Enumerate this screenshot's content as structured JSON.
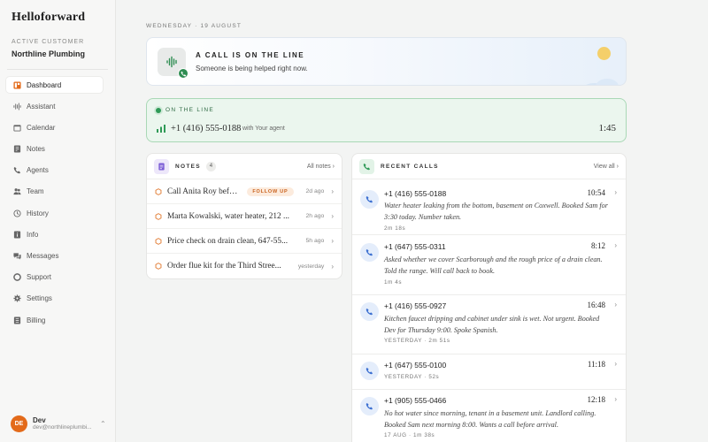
{
  "sidebar": {
    "brand": "Helloforward",
    "customer_label": "ACTIVE CUSTOMER",
    "customer_name": "Northline Plumbing",
    "items": [
      {
        "label": "Dashboard",
        "icon": "dashboard-icon",
        "active": true
      },
      {
        "label": "Assistant",
        "icon": "waveform-icon"
      },
      {
        "label": "Calendar",
        "icon": "calendar-icon"
      },
      {
        "label": "Notes",
        "icon": "note-icon"
      },
      {
        "label": "Agents",
        "icon": "phone-icon"
      },
      {
        "label": "Team",
        "icon": "team-icon"
      },
      {
        "label": "History",
        "icon": "history-icon"
      },
      {
        "label": "Info",
        "icon": "info-icon"
      },
      {
        "label": "Messages",
        "icon": "messages-icon"
      },
      {
        "label": "Support",
        "icon": "support-icon"
      },
      {
        "label": "Settings",
        "icon": "gear-icon"
      },
      {
        "label": "Billing",
        "icon": "billing-icon"
      }
    ],
    "user": {
      "initials": "DE",
      "name": "Dev",
      "email": "dev@northlineplumbi..."
    }
  },
  "main": {
    "date": "WEDNESDAY · 19 AUGUST",
    "banner": {
      "title": "A CALL IS ON THE LINE",
      "subtitle": "Someone is being helped right now."
    },
    "on_line": {
      "label": "ON THE LINE",
      "number": "+1 (416) 555-0188",
      "agent": "with Your agent",
      "duration": "1:45"
    },
    "notes": {
      "title": "NOTES",
      "count": "4",
      "link": "All notes",
      "items": [
        {
          "text": "Call Anita Roy before ...",
          "tag": "FOLLOW UP",
          "age": "2d ago"
        },
        {
          "text": "Marta Kowalski, water heater, 212 ...",
          "tag": "",
          "age": "2h ago"
        },
        {
          "text": "Price check on drain clean, 647-55...",
          "tag": "",
          "age": "5h ago"
        },
        {
          "text": "Order flue kit for the Third Stree...",
          "tag": "",
          "age": "yesterday"
        }
      ]
    },
    "calls": {
      "title": "RECENT CALLS",
      "link": "View all",
      "items": [
        {
          "number": "+1 (416) 555-0188",
          "time": "10:54",
          "desc": "Water heater leaking from the bottom, basement on Coxwell. Booked Sam for 3:30 today. Number taken.",
          "meta": "2m 18s"
        },
        {
          "number": "+1 (647) 555-0311",
          "time": "8:12",
          "desc": "Asked whether we cover Scarborough and the rough price of a drain clean. Told the range. Will call back to book.",
          "meta": "1m 4s"
        },
        {
          "number": "+1 (416) 555-0927",
          "time": "16:48",
          "desc": "Kitchen faucet dripping and cabinet under sink is wet. Not urgent. Booked Dev for Thursday 9:00. Spoke Spanish.",
          "meta": "YESTERDAY · 2m 51s"
        },
        {
          "number": "+1 (647) 555-0100",
          "time": "11:18",
          "desc": "",
          "meta": "YESTERDAY · 52s"
        },
        {
          "number": "+1 (905) 555-0466",
          "time": "12:18",
          "desc": "No hot water since morning, tenant in a basement unit. Landlord calling. Booked Sam next morning 8:00. Wants a call before arrival.",
          "meta": "17 AUG · 1m 38s"
        }
      ]
    }
  },
  "colors": {
    "accent_green": "#2f9a57",
    "accent_orange": "#e36a1a",
    "followup_bg": "#fcebdd"
  }
}
